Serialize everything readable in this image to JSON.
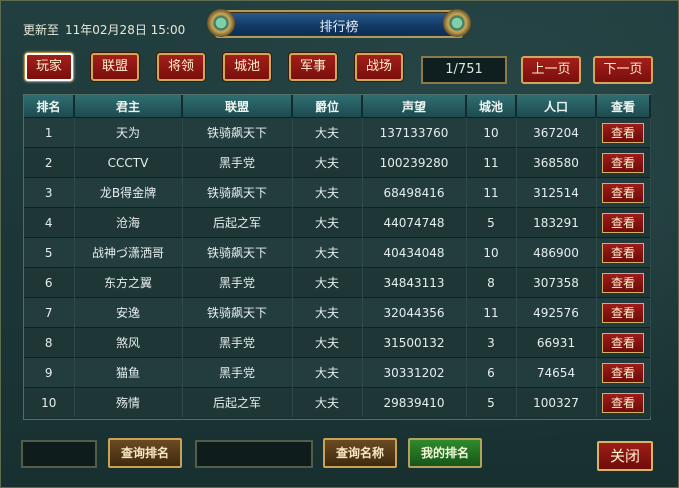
{
  "header": {
    "update_label": "更新至",
    "update_time": "11年02月28日 15:00",
    "title": "排行榜"
  },
  "tabs": [
    "玩家",
    "联盟",
    "将领",
    "城池",
    "军事",
    "战场"
  ],
  "pagination": {
    "page": "1/751",
    "prev": "上一页",
    "next": "下一页"
  },
  "table": {
    "columns": [
      "排名",
      "君主",
      "联盟",
      "爵位",
      "声望",
      "城池",
      "人口",
      "查看"
    ],
    "view_label": "查看",
    "rows": [
      [
        "1",
        "天为",
        "铁骑飙天下",
        "大夫",
        "137133760",
        "10",
        "367204"
      ],
      [
        "2",
        "CCCTV",
        "黑手党",
        "大夫",
        "100239280",
        "11",
        "368580"
      ],
      [
        "3",
        "龙B得金牌",
        "铁骑飙天下",
        "大夫",
        "68498416",
        "11",
        "312514"
      ],
      [
        "4",
        "沧海",
        "后起之军",
        "大夫",
        "44074748",
        "5",
        "183291"
      ],
      [
        "5",
        "战神づ潇洒哥",
        "铁骑飙天下",
        "大夫",
        "40434048",
        "10",
        "486900"
      ],
      [
        "6",
        "东方之翼",
        "黑手党",
        "大夫",
        "34843113",
        "8",
        "307358"
      ],
      [
        "7",
        "安逸",
        "铁骑飙天下",
        "大夫",
        "32044356",
        "11",
        "492576"
      ],
      [
        "8",
        "煞风",
        "黑手党",
        "大夫",
        "31500132",
        "3",
        "66931"
      ],
      [
        "9",
        "猫鱼",
        "黑手党",
        "大夫",
        "30331202",
        "6",
        "74654"
      ],
      [
        "10",
        "殇情",
        "后起之军",
        "大夫",
        "29839410",
        "5",
        "100327"
      ]
    ]
  },
  "footer": {
    "query_rank": "查询排名",
    "query_name": "查询名称",
    "my_rank": "我的排名",
    "close": "关闭"
  }
}
